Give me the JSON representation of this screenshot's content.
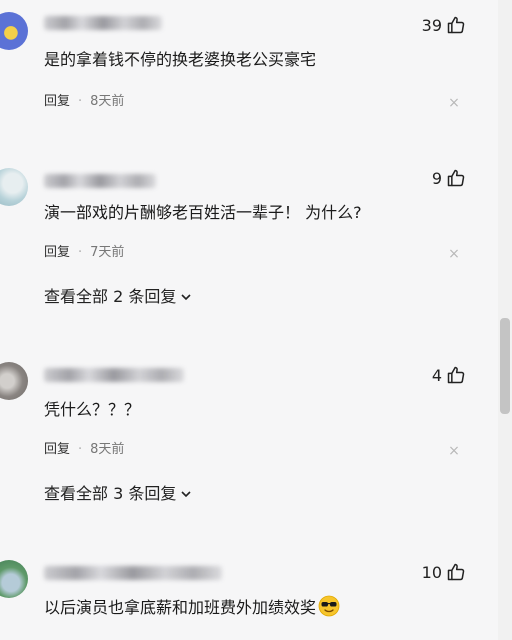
{
  "comments": [
    {
      "text": "是的拿着钱不停的换老婆换老公买豪宅",
      "like_count": "39",
      "reply_label": "回复",
      "separator": "·",
      "time": "8天前",
      "close_label": "×",
      "avatar_colors": [
        "#5b72d6",
        "#f4d04a"
      ]
    },
    {
      "text": "演一部戏的片酬够老百姓活一辈子！  为什么?",
      "like_count": "9",
      "reply_label": "回复",
      "separator": "·",
      "time": "7天前",
      "close_label": "×",
      "view_replies_label": "查看全部 2 条回复",
      "avatar_colors": [
        "#b7d2d9",
        "#e7eef0"
      ]
    },
    {
      "text": "凭什么？？？",
      "like_count": "4",
      "reply_label": "回复",
      "separator": "·",
      "time": "8天前",
      "close_label": "×",
      "view_replies_label": "查看全部 3 条回复",
      "avatar_colors": [
        "#6f6a67",
        "#d2cfcc"
      ]
    },
    {
      "text": "以后演员也拿底薪和加班费外加绩效奖",
      "like_count": "10",
      "avatar_colors": [
        "#5f9a6a",
        "#b5cbd8"
      ],
      "emoji_icon": "sunglasses-emoji-icon"
    }
  ],
  "icons": {
    "like": "thumbs-up-icon",
    "expand": "chevron-down-icon",
    "close": "close-icon"
  }
}
